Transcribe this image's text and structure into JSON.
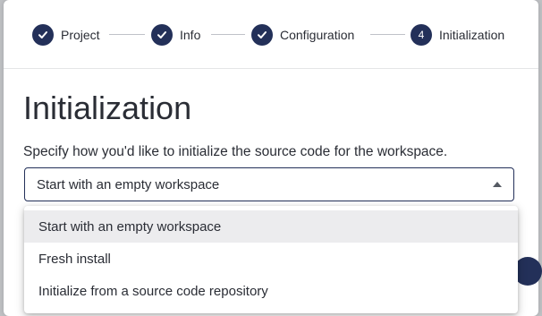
{
  "stepper": {
    "steps": [
      {
        "label": "Project",
        "state": "complete"
      },
      {
        "label": "Info",
        "state": "complete"
      },
      {
        "label": "Configuration",
        "state": "complete"
      },
      {
        "label": "Initialization",
        "number": "4",
        "state": "current"
      }
    ]
  },
  "page": {
    "title": "Initialization",
    "description": "Specify how you'd like to initialize the source code for the workspace."
  },
  "init_select": {
    "value": "Start with an empty workspace",
    "caret_icon": "caret-up-icon",
    "options": [
      {
        "label": "Start with an empty workspace",
        "selected": true
      },
      {
        "label": "Fresh install",
        "selected": false
      },
      {
        "label": "Initialize from a source code repository",
        "selected": false
      }
    ]
  },
  "colors": {
    "accent": "#233059",
    "text": "#2a2d35",
    "selected_option_bg": "#ececee"
  }
}
